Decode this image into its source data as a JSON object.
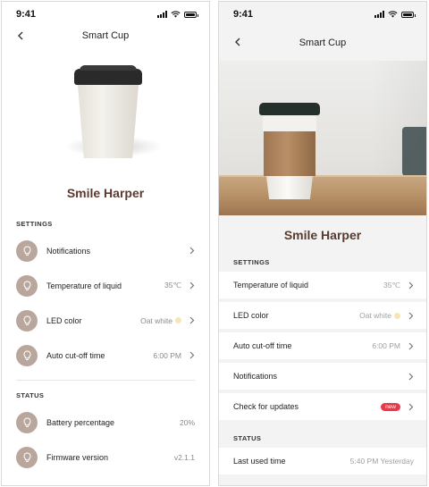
{
  "left": {
    "status_time": "9:41",
    "nav_title": "Smart Cup",
    "device_name": "Smile Harper",
    "settings_label": "SETTINGS",
    "settings": [
      {
        "label": "Notifications",
        "value": ""
      },
      {
        "label": "Temperature of liquid",
        "value": "35℃"
      },
      {
        "label": "LED color",
        "value": "Oat white"
      },
      {
        "label": "Auto cut-off time",
        "value": "6:00 PM"
      }
    ],
    "status_label": "STATUS",
    "status": [
      {
        "label": "Battery percentage",
        "value": "20%"
      },
      {
        "label": "Firmware version",
        "value": "v2.1.1"
      }
    ]
  },
  "right": {
    "status_time": "9:41",
    "nav_title": "Smart Cup",
    "device_name": "Smile Harper",
    "settings_label": "SETTINGS",
    "settings": [
      {
        "label": "Temperature of liquid",
        "value": "35℃"
      },
      {
        "label": "LED color",
        "value": "Oat white"
      },
      {
        "label": "Auto cut-off time",
        "value": "6:00 PM"
      },
      {
        "label": "Notifications",
        "value": ""
      },
      {
        "label": "Check for updates",
        "badge": "new"
      }
    ],
    "status_label": "STATUS",
    "status": [
      {
        "label": "Last used time",
        "value": "5:40 PM Yesterday"
      }
    ]
  },
  "colors": {
    "brand_brown": "#5a3a30",
    "icon_bubble": "#b9a79d",
    "led_swatch": "#f6e6b4",
    "badge_red": "#e8394a"
  },
  "icons": {
    "back": "chevron-left-icon",
    "row_chevron": "chevron-right-icon",
    "row_icon": "lightbulb-icon"
  }
}
